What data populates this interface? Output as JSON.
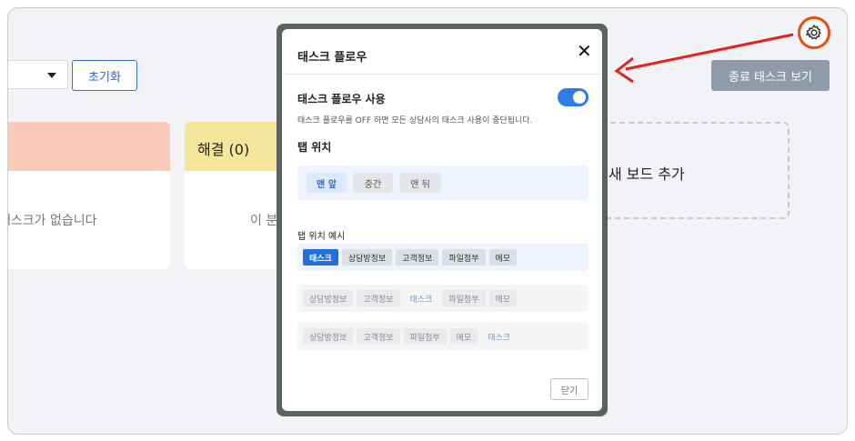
{
  "toolbar": {
    "reset_label": "초기화",
    "closed_tasks_label": "종료 태스크 보기"
  },
  "columns": [
    {
      "title": "",
      "empty_text": "태스크가 없습니다"
    },
    {
      "title": "해결 (0)",
      "empty_text": "이 분"
    }
  ],
  "add_board": {
    "label": "새 보드 추가"
  },
  "modal": {
    "title": "태스크 플로우",
    "close_glyph": "✕",
    "use_label": "태스크 플로우 사용",
    "use_enabled": true,
    "use_desc": "태스크 플로우를 OFF 하면 모든 상담사의 태스크 사용이 중단됩니다.",
    "tab_position_label": "탭 위치",
    "positions": [
      "맨 앞",
      "중간",
      "맨 뒤"
    ],
    "selected_position": "맨 앞",
    "example_label": "탭 위치 예시",
    "example_rows": [
      [
        "태스크",
        "상담방정보",
        "고객정보",
        "파일첨부",
        "메모"
      ],
      [
        "상담방정보",
        "고객정보",
        "태스크",
        "파일첨부",
        "메모"
      ],
      [
        "상담방정보",
        "고객정보",
        "파일첨부",
        "메모",
        "태스크"
      ]
    ],
    "done_label": "닫기"
  },
  "colors": {
    "accent": "#2f7ce8",
    "highlight": "#f04a12",
    "arrow": "#e8201a"
  }
}
